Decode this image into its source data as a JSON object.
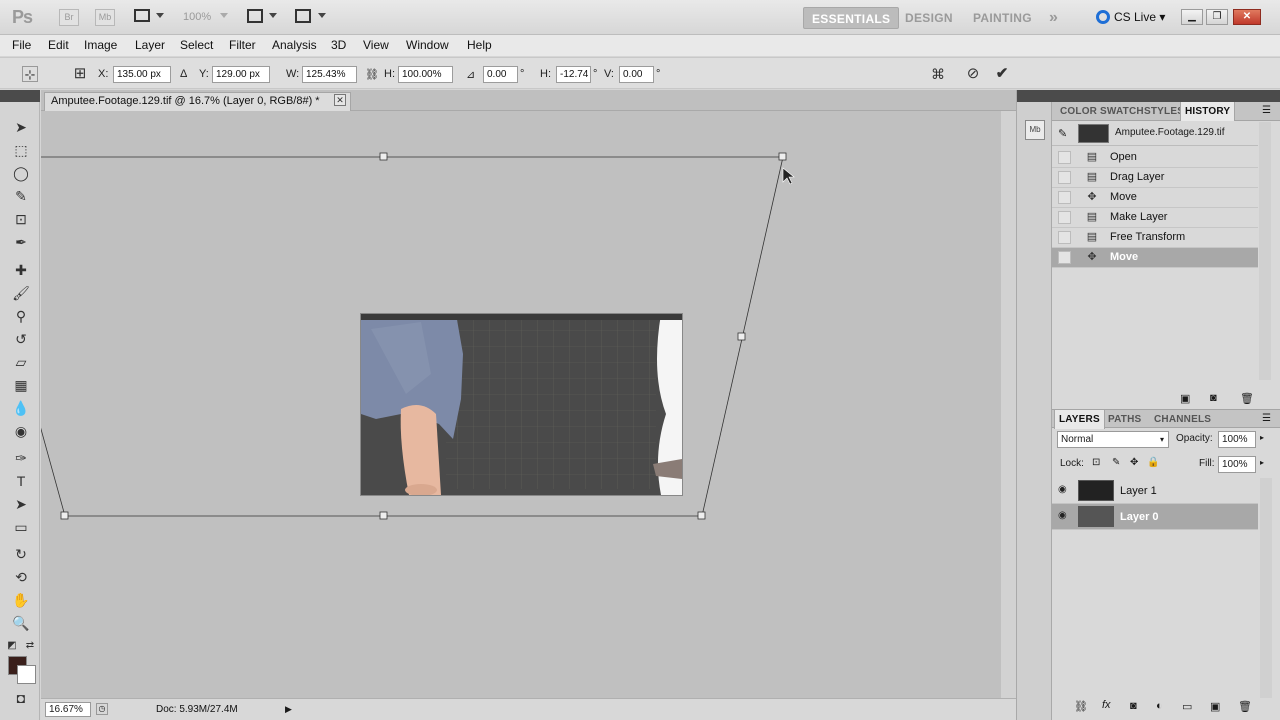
{
  "appbar": {
    "logo": "Ps",
    "bridge": "Br",
    "minibridge": "Mb",
    "zoom": "100%",
    "workspaces": [
      {
        "label": "ESSENTIALS",
        "active": true
      },
      {
        "label": "DESIGN",
        "active": false
      },
      {
        "label": "PAINTING",
        "active": false
      }
    ],
    "more": "»",
    "cslive": "CS Live"
  },
  "menu": [
    "File",
    "Edit",
    "Image",
    "Layer",
    "Select",
    "Filter",
    "Analysis",
    "3D",
    "View",
    "Window",
    "Help"
  ],
  "options": {
    "x_label": "X:",
    "x_value": "135.00 px",
    "y_label": "Y:",
    "y_value": "129.00 px",
    "w_label": "W:",
    "w_value": "125.43%",
    "h_label": "H:",
    "h_value": "100.00%",
    "angle_value": "0.00",
    "skewh_label": "H:",
    "skewh_value": "-12.74",
    "skewv_label": "V:",
    "skewv_value": "0.00",
    "deg": "°"
  },
  "document": {
    "tab_title": "Amputee.Footage.129.tif @ 16.7% (Layer 0, RGB/8#) *",
    "zoom": "16.67%",
    "doc_info": "Doc: 5.93M/27.4M"
  },
  "colors": {
    "foreground": "#3a1f1b",
    "background": "#ffffff",
    "accent": "#1f6fd6"
  },
  "history_panel": {
    "tabs": [
      {
        "label": "COLOR",
        "active": false
      },
      {
        "label": "SWATCH",
        "active": false
      },
      {
        "label": "STYLES",
        "active": false
      },
      {
        "label": "HISTORY",
        "active": true
      }
    ],
    "snapshot": "Amputee.Footage.129.tif",
    "items": [
      {
        "label": "Open",
        "icon": "document-icon",
        "selected": false
      },
      {
        "label": "Drag Layer",
        "icon": "document-icon",
        "selected": false
      },
      {
        "label": "Move",
        "icon": "move-icon",
        "selected": false
      },
      {
        "label": "Make Layer",
        "icon": "document-icon",
        "selected": false
      },
      {
        "label": "Free Transform",
        "icon": "document-icon",
        "selected": false
      },
      {
        "label": "Move",
        "icon": "move-icon",
        "selected": true
      }
    ]
  },
  "layers_panel": {
    "tabs": [
      {
        "label": "LAYERS",
        "active": true
      },
      {
        "label": "PATHS",
        "active": false
      },
      {
        "label": "CHANNELS",
        "active": false
      }
    ],
    "blend_mode": "Normal",
    "opacity_label": "Opacity:",
    "opacity_value": "100%",
    "lock_label": "Lock:",
    "fill_label": "Fill:",
    "fill_value": "100%",
    "layers": [
      {
        "name": "Layer 1",
        "selected": false
      },
      {
        "name": "Layer 0",
        "selected": true
      }
    ]
  }
}
